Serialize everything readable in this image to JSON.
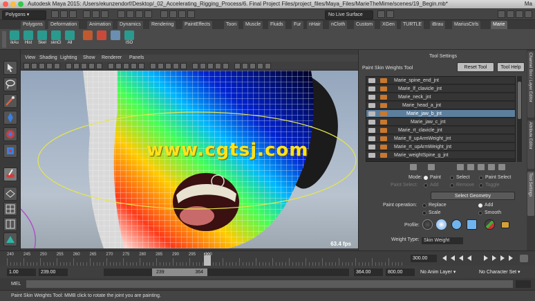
{
  "window": {
    "title": "Autodesk Maya 2015: /Users/ekunzendorf/Desktop/_02_Accelerating_Rigging_Process/6. Final Project Files/project_files/Maya_Files/MarieTheMime/scenes/19_Begin.mb*",
    "right_text": "Ma"
  },
  "status_line": {
    "menuset": "Polygons",
    "live_surface": "No Live Surface"
  },
  "shelf_tabs": [
    "Polygons",
    "Deformation",
    "Animation",
    "Dynamics",
    "Rendering",
    "PaintEffects",
    "Toon",
    "Muscle",
    "Fluids",
    "Fur",
    "nHair",
    "nCloth",
    "Custom",
    "XGen",
    "TURTLE",
    "iBrau",
    "MariusCtrls",
    "Marie"
  ],
  "shelf_buttons": [
    "ikAu",
    "Hist",
    "Skel",
    "sknCl",
    "All",
    "",
    "",
    "",
    "",
    "ISO"
  ],
  "viewport": {
    "menu": [
      "View",
      "Shading",
      "Lighting",
      "Show",
      "Renderer",
      "Panels"
    ],
    "fps": "63.4 fps",
    "watermark": "www.cgtsj.com"
  },
  "tool_settings": {
    "header": "Tool Settings",
    "tool_name": "Paint Skin Weights Tool",
    "reset_label": "Reset Tool",
    "help_label": "Tool Help",
    "influences": [
      {
        "name": "Marie_spine_end_jnt",
        "indent": 0,
        "selected": false
      },
      {
        "name": "Marie_lf_clavicle_jnt",
        "indent": 1,
        "selected": false
      },
      {
        "name": "Marie_neck_jnt",
        "indent": 1,
        "selected": false
      },
      {
        "name": "Marie_head_a_jnt",
        "indent": 2,
        "selected": false
      },
      {
        "name": "Marie_jaw_b_jnt",
        "indent": 3,
        "selected": true
      },
      {
        "name": "Marie_jaw_c_jnt",
        "indent": 4,
        "selected": false
      },
      {
        "name": "Marie_rt_clavicle_jnt",
        "indent": 1,
        "selected": false
      },
      {
        "name": "Marie_lf_upArmWeight_jnt",
        "indent": 0,
        "selected": false
      },
      {
        "name": "Marie_rt_upArmWeight_jnt",
        "indent": 0,
        "selected": false
      },
      {
        "name": "Marie_weightSpine_g_jnt",
        "indent": 0,
        "selected": false
      }
    ],
    "mode_label": "Mode:",
    "mode_options": [
      "Paint",
      "Select",
      "Paint Select"
    ],
    "paint_select_label": "Paint Select:",
    "paint_select_options": [
      "Add",
      "Remove",
      "Toggle"
    ],
    "select_geometry_label": "Select Geometry",
    "paint_operation_label": "Paint operation:",
    "paint_operations": [
      "Replace",
      "Add",
      "Scale",
      "Smooth"
    ],
    "profile_label": "Profile:",
    "weight_type_label": "Weight Type:",
    "weight_type_value": "Skin Weight"
  },
  "side_tabs": [
    "Channel Box / Layer Editor",
    "Attribute Editor",
    "Tool Settings"
  ],
  "timeline": {
    "ticks": [
      "240",
      "245",
      "250",
      "255",
      "260",
      "265",
      "270",
      "275",
      "280",
      "285",
      "290",
      "295",
      "300"
    ],
    "current_frame": "300",
    "current_frame_box": "300.00"
  },
  "range": {
    "start": "1.00",
    "playback_start": "239.00",
    "handle_start": "239",
    "handle_end": "364",
    "playback_end": "364.00",
    "end": "800.00",
    "anim_layer": "No Anim Layer",
    "character_set": "No Character Set"
  },
  "command_line": {
    "label": "MEL"
  },
  "help_line": "Paint Skin Weights Tool: MMB click to rotate the joint you are painting."
}
